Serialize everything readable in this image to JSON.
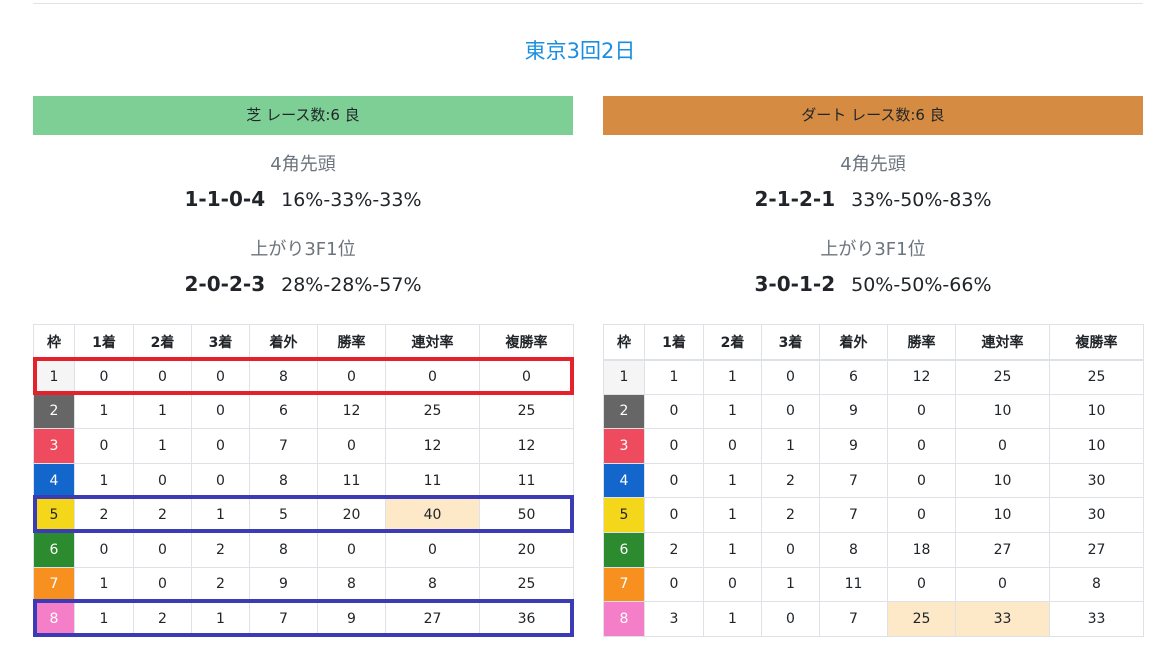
{
  "page_title": "東京3回2日",
  "headers": [
    "枠",
    "1着",
    "2着",
    "3着",
    "着外",
    "勝率",
    "連対率",
    "複勝率"
  ],
  "gate_colors": {
    "1": {
      "bg": "#f5f5f5",
      "fg": "#212529"
    },
    "2": {
      "bg": "#666666",
      "fg": "#ffffff"
    },
    "3": {
      "bg": "#ee4b5e",
      "fg": "#ffffff"
    },
    "4": {
      "bg": "#1266cc",
      "fg": "#ffffff"
    },
    "5": {
      "bg": "#f4d61b",
      "fg": "#212529"
    },
    "6": {
      "bg": "#2c8a2f",
      "fg": "#ffffff"
    },
    "7": {
      "bg": "#f7901e",
      "fg": "#ffffff"
    },
    "8": {
      "bg": "#f57ec9",
      "fg": "#ffffff"
    }
  },
  "highlight_color": "#fde8c8",
  "turf": {
    "band_label": "芝 レース数:6  良",
    "band_color": "#7dcf96",
    "corner_lead": {
      "title": "4角先頭",
      "record": [
        "1",
        "1",
        "0",
        "4"
      ],
      "pct": "16%-33%-33%"
    },
    "last3f": {
      "title": "上がり3F1位",
      "record": [
        "2",
        "0",
        "2",
        "3"
      ],
      "pct": "28%-28%-57%"
    },
    "rows": [
      {
        "gate": "1",
        "cells": [
          "0",
          "0",
          "0",
          "8",
          "0",
          "0",
          "0"
        ],
        "hl": []
      },
      {
        "gate": "2",
        "cells": [
          "1",
          "1",
          "0",
          "6",
          "12",
          "25",
          "25"
        ],
        "hl": []
      },
      {
        "gate": "3",
        "cells": [
          "0",
          "1",
          "0",
          "7",
          "0",
          "12",
          "12"
        ],
        "hl": []
      },
      {
        "gate": "4",
        "cells": [
          "1",
          "0",
          "0",
          "8",
          "11",
          "11",
          "11"
        ],
        "hl": []
      },
      {
        "gate": "5",
        "cells": [
          "2",
          "2",
          "1",
          "5",
          "20",
          "40",
          "50"
        ],
        "hl": [
          5
        ]
      },
      {
        "gate": "6",
        "cells": [
          "0",
          "0",
          "2",
          "8",
          "0",
          "0",
          "20"
        ],
        "hl": []
      },
      {
        "gate": "7",
        "cells": [
          "1",
          "0",
          "2",
          "9",
          "8",
          "8",
          "25"
        ],
        "hl": []
      },
      {
        "gate": "8",
        "cells": [
          "1",
          "2",
          "1",
          "7",
          "9",
          "27",
          "36"
        ],
        "hl": []
      }
    ],
    "annotations": [
      {
        "row": 0,
        "color": "red"
      },
      {
        "row": 4,
        "color": "blue"
      },
      {
        "row": 7,
        "color": "blue"
      }
    ]
  },
  "dirt": {
    "band_label": "ダート レース数:6  良",
    "band_color": "#d58c42",
    "corner_lead": {
      "title": "4角先頭",
      "record": [
        "2",
        "1",
        "2",
        "1"
      ],
      "pct": "33%-50%-83%"
    },
    "last3f": {
      "title": "上がり3F1位",
      "record": [
        "3",
        "0",
        "1",
        "2"
      ],
      "pct": "50%-50%-66%"
    },
    "rows": [
      {
        "gate": "1",
        "cells": [
          "1",
          "1",
          "0",
          "6",
          "12",
          "25",
          "25"
        ],
        "hl": []
      },
      {
        "gate": "2",
        "cells": [
          "0",
          "1",
          "0",
          "9",
          "0",
          "10",
          "10"
        ],
        "hl": []
      },
      {
        "gate": "3",
        "cells": [
          "0",
          "0",
          "1",
          "9",
          "0",
          "0",
          "10"
        ],
        "hl": []
      },
      {
        "gate": "4",
        "cells": [
          "0",
          "1",
          "2",
          "7",
          "0",
          "10",
          "30"
        ],
        "hl": []
      },
      {
        "gate": "5",
        "cells": [
          "0",
          "1",
          "2",
          "7",
          "0",
          "10",
          "30"
        ],
        "hl": []
      },
      {
        "gate": "6",
        "cells": [
          "2",
          "1",
          "0",
          "8",
          "18",
          "27",
          "27"
        ],
        "hl": []
      },
      {
        "gate": "7",
        "cells": [
          "0",
          "0",
          "1",
          "11",
          "0",
          "0",
          "8"
        ],
        "hl": []
      },
      {
        "gate": "8",
        "cells": [
          "3",
          "1",
          "0",
          "7",
          "25",
          "33",
          "33"
        ],
        "hl": [
          4,
          5
        ]
      }
    ],
    "annotations": []
  }
}
